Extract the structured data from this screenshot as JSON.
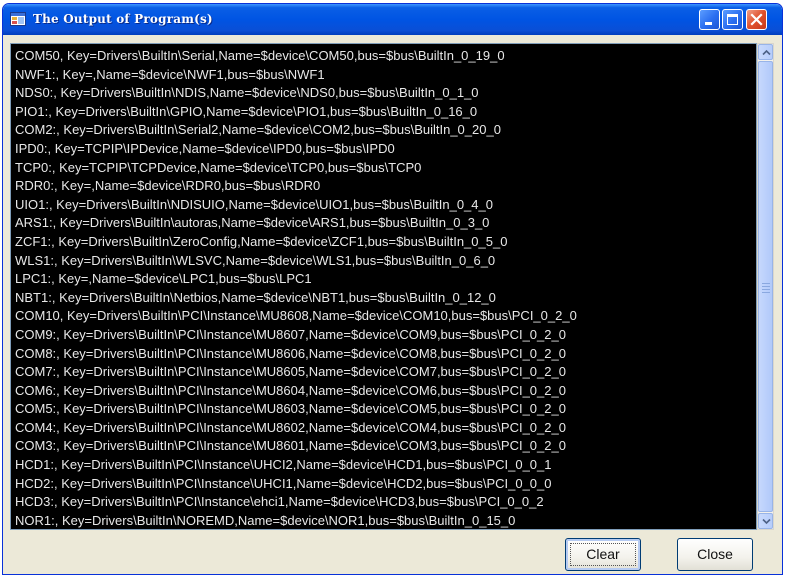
{
  "window": {
    "title": "The Output of Program(s)",
    "icon": "app-window-icon"
  },
  "titlebar_buttons": {
    "minimize": "minimize-icon",
    "maximize": "maximize-icon",
    "close": "close-icon"
  },
  "output": {
    "lines": [
      "COM50, Key=Drivers\\BuiltIn\\Serial,Name=$device\\COM50,bus=$bus\\BuiltIn_0_19_0",
      "NWF1:, Key=,Name=$device\\NWF1,bus=$bus\\NWF1",
      "NDS0:, Key=Drivers\\BuiltIn\\NDIS,Name=$device\\NDS0,bus=$bus\\BuiltIn_0_1_0",
      "PIO1:, Key=Drivers\\BuiltIn\\GPIO,Name=$device\\PIO1,bus=$bus\\BuiltIn_0_16_0",
      "COM2:, Key=Drivers\\BuiltIn\\Serial2,Name=$device\\COM2,bus=$bus\\BuiltIn_0_20_0",
      "IPD0:, Key=TCPIP\\IPDevice,Name=$device\\IPD0,bus=$bus\\IPD0",
      "TCP0:, Key=TCPIP\\TCPDevice,Name=$device\\TCP0,bus=$bus\\TCP0",
      "RDR0:, Key=,Name=$device\\RDR0,bus=$bus\\RDR0",
      "UIO1:, Key=Drivers\\BuiltIn\\NDISUIO,Name=$device\\UIO1,bus=$bus\\BuiltIn_0_4_0",
      "ARS1:, Key=Drivers\\BuiltIn\\autoras,Name=$device\\ARS1,bus=$bus\\BuiltIn_0_3_0",
      "ZCF1:, Key=Drivers\\BuiltIn\\ZeroConfig,Name=$device\\ZCF1,bus=$bus\\BuiltIn_0_5_0",
      "WLS1:, Key=Drivers\\BuiltIn\\WLSVC,Name=$device\\WLS1,bus=$bus\\BuiltIn_0_6_0",
      "LPC1:, Key=,Name=$device\\LPC1,bus=$bus\\LPC1",
      "NBT1:, Key=Drivers\\BuiltIn\\Netbios,Name=$device\\NBT1,bus=$bus\\BuiltIn_0_12_0",
      "COM10, Key=Drivers\\BuiltIn\\PCI\\Instance\\MU8608,Name=$device\\COM10,bus=$bus\\PCI_0_2_0",
      "COM9:, Key=Drivers\\BuiltIn\\PCI\\Instance\\MU8607,Name=$device\\COM9,bus=$bus\\PCI_0_2_0",
      "COM8:, Key=Drivers\\BuiltIn\\PCI\\Instance\\MU8606,Name=$device\\COM8,bus=$bus\\PCI_0_2_0",
      "COM7:, Key=Drivers\\BuiltIn\\PCI\\Instance\\MU8605,Name=$device\\COM7,bus=$bus\\PCI_0_2_0",
      "COM6:, Key=Drivers\\BuiltIn\\PCI\\Instance\\MU8604,Name=$device\\COM6,bus=$bus\\PCI_0_2_0",
      "COM5:, Key=Drivers\\BuiltIn\\PCI\\Instance\\MU8603,Name=$device\\COM5,bus=$bus\\PCI_0_2_0",
      "COM4:, Key=Drivers\\BuiltIn\\PCI\\Instance\\MU8602,Name=$device\\COM4,bus=$bus\\PCI_0_2_0",
      "COM3:, Key=Drivers\\BuiltIn\\PCI\\Instance\\MU8601,Name=$device\\COM3,bus=$bus\\PCI_0_2_0",
      "HCD1:, Key=Drivers\\BuiltIn\\PCI\\Instance\\UHCI2,Name=$device\\HCD1,bus=$bus\\PCI_0_0_1",
      "HCD2:, Key=Drivers\\BuiltIn\\PCI\\Instance\\UHCI1,Name=$device\\HCD2,bus=$bus\\PCI_0_0_0",
      "HCD3:, Key=Drivers\\BuiltIn\\PCI\\Instance\\ehci1,Name=$device\\HCD3,bus=$bus\\PCI_0_0_2",
      "NOR1:, Key=Drivers\\BuiltIn\\NOREMD,Name=$device\\NOR1,bus=$bus\\BuiltIn_0_15_0"
    ]
  },
  "buttons": {
    "clear": "Clear",
    "close": "Close"
  },
  "colors": {
    "titlebar": "#0054e3",
    "output_bg": "#000000",
    "output_text": "#e8e8e8",
    "dialog_bg": "#ece9d8"
  }
}
